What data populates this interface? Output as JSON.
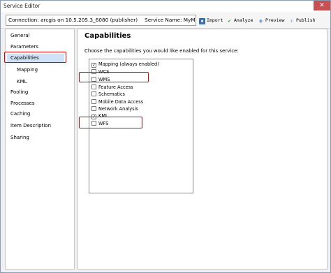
{
  "window": {
    "title": "Service Editor",
    "close_glyph": "✕"
  },
  "toolbar": {
    "connection_label": "Connection: arcgis on 10.5.205.3_6080 (publisher)",
    "service_name_label": "Service Name: MyM...",
    "buttons": [
      {
        "label": "Import",
        "icon": "save-icon"
      },
      {
        "label": "Analyze",
        "icon": "check-icon"
      },
      {
        "label": "Preview",
        "icon": "globe-icon"
      },
      {
        "label": "Publish",
        "icon": "publish-icon"
      }
    ]
  },
  "sidebar": {
    "items": [
      {
        "label": "General"
      },
      {
        "label": "Parameters"
      },
      {
        "label": "Capabilities",
        "selected": true
      },
      {
        "label": "Mapping",
        "indent": true
      },
      {
        "label": "KML",
        "indent": true
      },
      {
        "label": "Pooling"
      },
      {
        "label": "Processes"
      },
      {
        "label": "Caching"
      },
      {
        "label": "Item Description"
      },
      {
        "label": "Sharing"
      }
    ]
  },
  "main": {
    "title": "Capabilities",
    "description": "Choose the capabilities you would like enabled for this service:",
    "capabilities": [
      {
        "label": "Mapping (always enabled)",
        "checked": true
      },
      {
        "label": "WCS",
        "checked": false
      },
      {
        "label": "WMS",
        "checked": false
      },
      {
        "label": "Feature Access",
        "checked": false
      },
      {
        "label": "Schematics",
        "checked": false
      },
      {
        "label": "Mobile Data Access",
        "checked": false
      },
      {
        "label": "Network Analysis",
        "checked": false
      },
      {
        "label": "KML",
        "checked": true
      },
      {
        "label": "WFS",
        "checked": false
      }
    ]
  },
  "annotations": {
    "highlight_color": "#e00000"
  }
}
